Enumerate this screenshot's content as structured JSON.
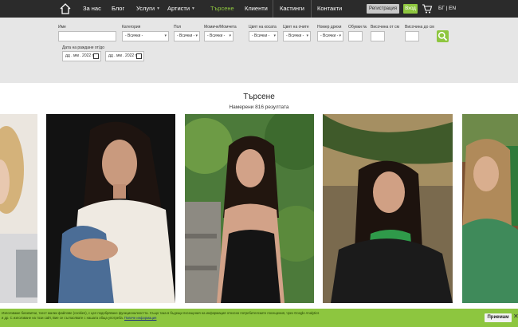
{
  "nav": {
    "items": [
      "За нас",
      "Блог",
      "Услуги",
      "Артисти",
      "Търсене",
      "Клиенти",
      "Кастинги",
      "Контакти"
    ],
    "register": "Регистрация",
    "login": "Вход",
    "lang": "БГ | EN"
  },
  "filters": {
    "labels": {
      "name": "Име",
      "category": "Категория",
      "gender": "Пол",
      "age": "Момиче/Момчета",
      "hair": "Цвят на косата",
      "eyes": "Цвят на очите",
      "clothes": "Номер дрехи",
      "shoes": "Обувки №",
      "height_from": "Височина от см",
      "height_to": "Височина до см",
      "birthdate": "Дата на раждане от/до"
    },
    "all_option": "- Всички -",
    "date_placeholder": "дд . мм . 2022 г."
  },
  "results": {
    "title": "Търсене",
    "count": "Намерени 816 резултата"
  },
  "cookie": {
    "text": "Използваме бисквитки, тоест малки файлове (cookies), с цел подобряване функционалността. Също така в бъдещи посещения на информация относно потребителските посещения, чрез Google Analytics и др. С използване на този сайт, Вие се съгласявате с нашата обща употреба.",
    "link": "Повече информация",
    "accept": "Приемам",
    "close": "✕"
  },
  "colors": {
    "accent": "#8ec63f",
    "nav_bg": "#2b2b2b",
    "filter_bg": "#e6e6e6"
  },
  "icons": {
    "home": "home-icon",
    "cart": "cart-icon",
    "search": "search-icon"
  }
}
